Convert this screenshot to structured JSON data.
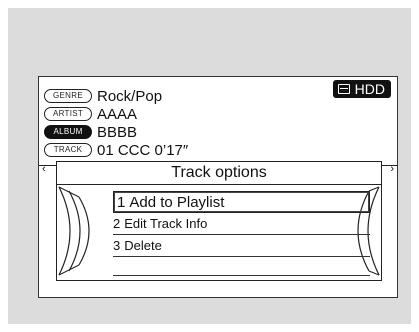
{
  "info": {
    "genre": {
      "tag": "GENRE",
      "value": "Rock/Pop"
    },
    "artist": {
      "tag": "ARTIST",
      "value": "AAAA"
    },
    "album": {
      "tag": "ALBUM",
      "value": "BBBB"
    },
    "track": {
      "tag": "TRACK",
      "value": "01 CCC  0’17″"
    }
  },
  "source": {
    "label": "HDD"
  },
  "popup": {
    "title": "Track options",
    "items": [
      {
        "num": "1",
        "label": "Add to Playlist"
      },
      {
        "num": "2",
        "label": "Edit Track Info"
      },
      {
        "num": "3",
        "label": "Delete"
      }
    ]
  }
}
